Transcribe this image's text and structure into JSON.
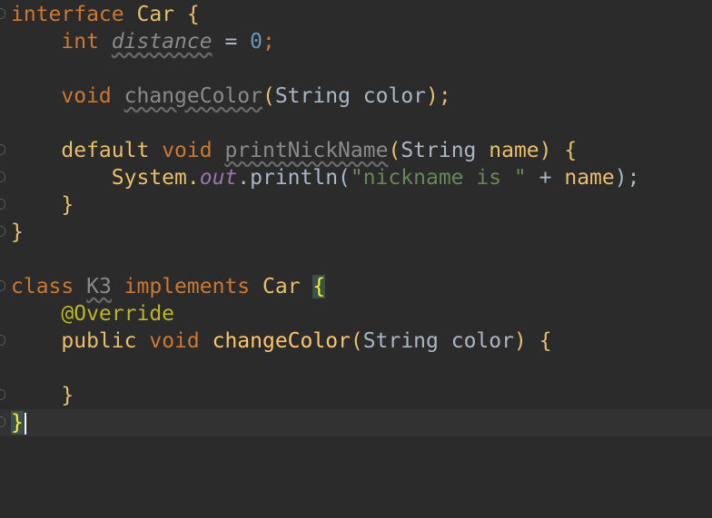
{
  "editor": {
    "lines": [
      [
        "interface",
        "Car",
        "{"
      ],
      [
        "int",
        "distance",
        "=",
        "0",
        ";"
      ],
      [],
      [
        "void",
        "changeColor",
        "(",
        "String",
        "color",
        ");"
      ],
      [],
      [
        "default",
        "void",
        "printNickName",
        "(",
        "String",
        "name",
        ")",
        "{"
      ],
      [
        "System.",
        "out",
        ".println(",
        "\"nickname is \"",
        "+",
        "name",
        ");"
      ],
      [
        "}"
      ],
      [
        "}"
      ],
      [],
      [
        "class",
        "K3",
        "implements",
        "Car",
        "{"
      ],
      [
        "@Override"
      ],
      [
        "public",
        "void",
        "changeColor",
        "(",
        "String",
        "color",
        ")",
        "{"
      ],
      [],
      [
        "}"
      ],
      [
        "}"
      ]
    ]
  },
  "colors": {
    "background": "#2b2b2b",
    "keyword": "#cc7832",
    "string": "#6a8759",
    "number": "#6897bb",
    "field": "#9876aa",
    "annotation": "#bbb529",
    "method_decl": "#ffc66d",
    "current_line": "#323232"
  }
}
